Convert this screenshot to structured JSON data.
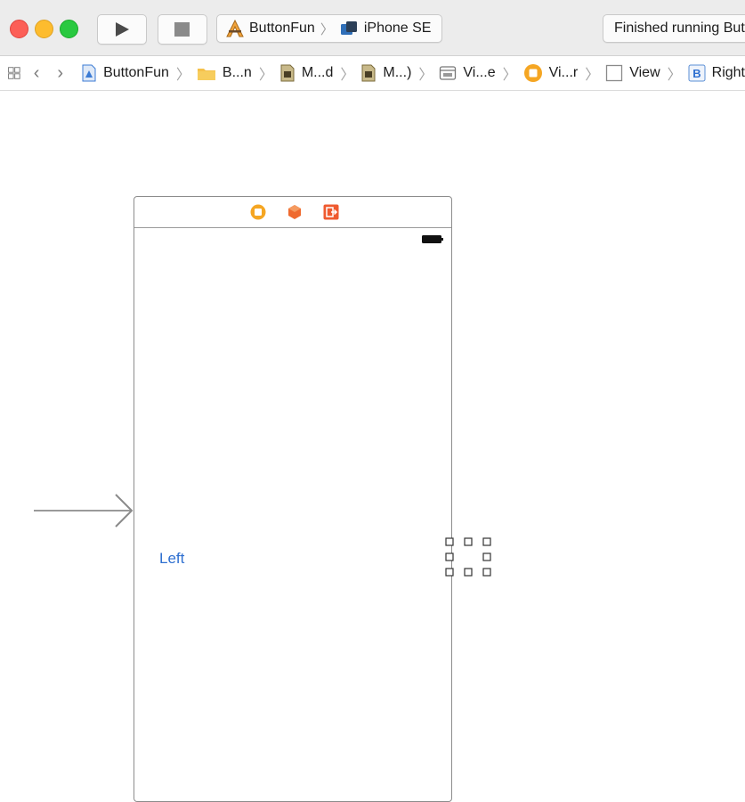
{
  "toolbar": {
    "run_label": "Run",
    "stop_label": "Stop",
    "scheme_name": "ButtonFun",
    "device_name": "iPhone SE",
    "status_text": "Finished running ButtonFun"
  },
  "jumpbar": {
    "crumbs": [
      {
        "label": "ButtonFun",
        "icon": "project-file-icon"
      },
      {
        "label": "B...n",
        "icon": "folder-icon"
      },
      {
        "label": "M...d",
        "icon": "storyboard-icon"
      },
      {
        "label": "M...)",
        "icon": "storyboard-icon"
      },
      {
        "label": "Vi...e",
        "icon": "scene-icon"
      },
      {
        "label": "Vi...r",
        "icon": "view-controller-icon"
      },
      {
        "label": "View",
        "icon": "view-icon"
      },
      {
        "label": "Right",
        "icon": "button-icon",
        "icon_letter": "B"
      }
    ]
  },
  "canvas": {
    "left_button_label": "Left"
  },
  "colors": {
    "accent_blue": "#2e6fd0",
    "dock_orange": "#f5a623",
    "dock_red": "#ef5a2f"
  }
}
